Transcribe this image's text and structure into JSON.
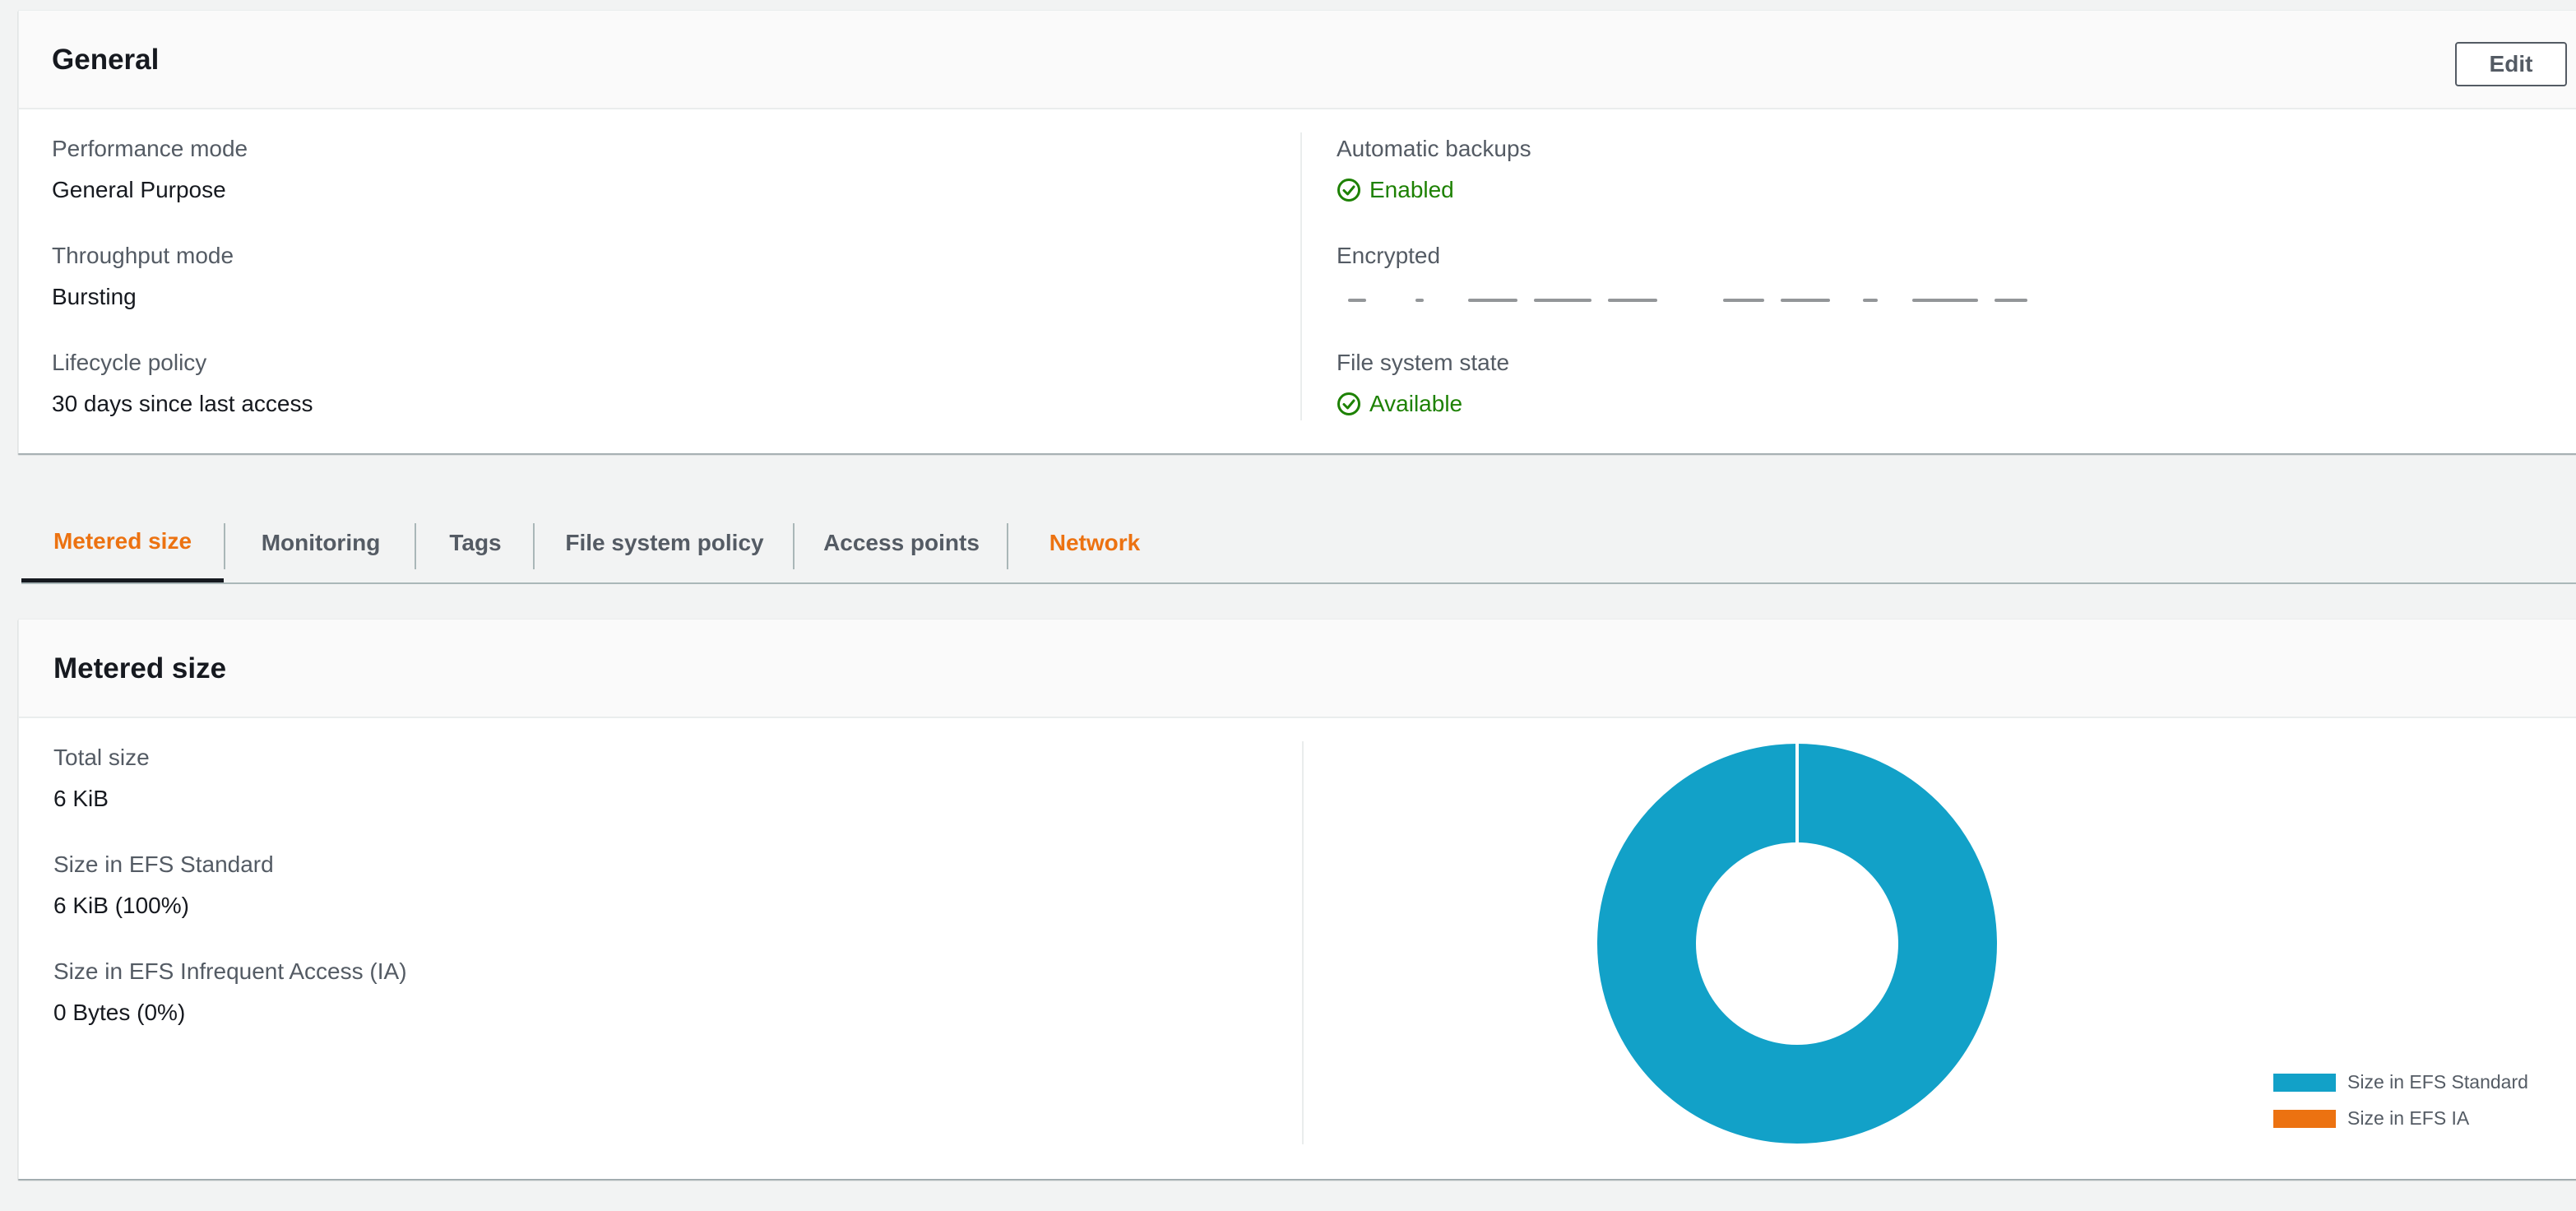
{
  "general": {
    "title": "General",
    "edit_label": "Edit",
    "left": [
      {
        "label": "Performance mode",
        "value": "General Purpose"
      },
      {
        "label": "Throughput mode",
        "value": "Bursting"
      },
      {
        "label": "Lifecycle policy",
        "value": "30 days since last access"
      }
    ],
    "right": {
      "backups_label": "Automatic backups",
      "backups_value": "Enabled",
      "encrypted_label": "Encrypted",
      "state_label": "File system state",
      "state_value": "Available"
    }
  },
  "tabs": [
    {
      "label": "Metered size",
      "active": true
    },
    {
      "label": "Monitoring",
      "active": false
    },
    {
      "label": "Tags",
      "active": false
    },
    {
      "label": "File system policy",
      "active": false
    },
    {
      "label": "Access points",
      "active": false
    },
    {
      "label": "Network",
      "active": false
    }
  ],
  "metered": {
    "title": "Metered size",
    "items": [
      {
        "label": "Total size",
        "value": "6 KiB"
      },
      {
        "label": "Size in EFS Standard",
        "value": "6 KiB (100%)"
      },
      {
        "label": "Size in EFS Infrequent Access (IA)",
        "value": "0 Bytes (0%)"
      }
    ]
  },
  "colors": {
    "accent": "#ec7211",
    "success": "#1d8102",
    "standard": "#12a1c8",
    "ia": "#ec7211"
  },
  "chart_data": {
    "type": "pie",
    "donut": true,
    "categories": [
      "Size in EFS Standard",
      "Size in EFS IA"
    ],
    "values": [
      100,
      0
    ],
    "colors": [
      "#12a1c8",
      "#ec7211"
    ],
    "legend": "bottom-right"
  }
}
